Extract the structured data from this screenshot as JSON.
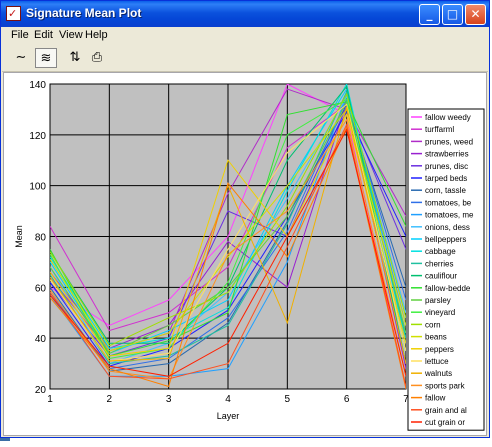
{
  "window": {
    "title": "Signature Mean Plot",
    "app_icon": "signature-plot-app-icon",
    "controls": [
      "minimize",
      "maximize",
      "close"
    ],
    "minimize_glyph": "_",
    "maximize_glyph": "□",
    "close_glyph": "✕",
    "app_icon_glyph": "✓"
  },
  "menu": [
    "File",
    "Edit",
    "View",
    "Help"
  ],
  "toolbar": {
    "tools": [
      {
        "name": "line-plot-icon",
        "glyph": "∼"
      },
      {
        "name": "multi-line-plot-icon",
        "glyph": "≋"
      },
      {
        "name": "switch-axes-icon",
        "glyph": "⇅"
      },
      {
        "name": "print-icon",
        "glyph": "⎙"
      }
    ]
  },
  "chart_data": {
    "type": "line",
    "xlabel": "Layer",
    "ylabel": "Mean",
    "x": [
      1,
      2,
      3,
      4,
      5,
      6,
      7
    ],
    "xlim": [
      1,
      7
    ],
    "ylim": [
      20,
      140
    ],
    "yticks": [
      20,
      40,
      60,
      80,
      100,
      120,
      140
    ],
    "grid": true,
    "background": "#c0c0c0",
    "legend_position": "right",
    "series": [
      {
        "name": "fallow weedy",
        "color": "#ff40ff",
        "values": [
          60,
          45,
          55,
          80,
          140,
          128,
          20
        ]
      },
      {
        "name": "turffarml",
        "color": "#d030d0",
        "values": [
          84,
          43,
          50,
          68,
          115,
          132,
          30
        ]
      },
      {
        "name": "prunes, weed",
        "color": "#b02cc8",
        "values": [
          64,
          35,
          42,
          97,
          138,
          130,
          88
        ]
      },
      {
        "name": "strawberries",
        "color": "#9920d0",
        "values": [
          66,
          36,
          45,
          78,
          60,
          133,
          28
        ]
      },
      {
        "name": "prunes, disc",
        "color": "#6a30e0",
        "values": [
          62,
          33,
          40,
          90,
          80,
          131,
          75
        ]
      },
      {
        "name": "tarped beds",
        "color": "#2020ff",
        "values": [
          62,
          29,
          36,
          51,
          88,
          129,
          80
        ]
      },
      {
        "name": "corn, tassle",
        "color": "#2a6ab0",
        "values": [
          60,
          27,
          30,
          46,
          86,
          132,
          60
        ]
      },
      {
        "name": "tomatoes, be",
        "color": "#3070e8",
        "values": [
          58,
          28,
          32,
          48,
          82,
          134,
          55
        ]
      },
      {
        "name": "tomatoes, me",
        "color": "#20a0ff",
        "values": [
          57,
          25,
          25,
          28,
          70,
          136,
          45
        ]
      },
      {
        "name": "onions, dess",
        "color": "#40c0ff",
        "values": [
          68,
          30,
          38,
          58,
          95,
          135,
          50
        ]
      },
      {
        "name": "bellpeppers",
        "color": "#00d0ff",
        "values": [
          70,
          34,
          43,
          55,
          100,
          138,
          40
        ]
      },
      {
        "name": "cabbage",
        "color": "#00e0e0",
        "values": [
          72,
          36,
          40,
          52,
          98,
          140,
          38
        ]
      },
      {
        "name": "cherries",
        "color": "#20c0a0",
        "values": [
          65,
          30,
          33,
          45,
          85,
          137,
          40
        ]
      },
      {
        "name": "cauliflour",
        "color": "#00c070",
        "values": [
          74,
          38,
          38,
          60,
          110,
          139,
          30
        ]
      },
      {
        "name": "fallow-bedde",
        "color": "#30e030",
        "values": [
          75,
          33,
          39,
          50,
          128,
          133,
          84
        ]
      },
      {
        "name": "parsley",
        "color": "#60d040",
        "values": [
          68,
          34,
          45,
          60,
          88,
          133,
          42
        ]
      },
      {
        "name": "vineyard",
        "color": "#40f040",
        "values": [
          73,
          32,
          36,
          62,
          120,
          134,
          35
        ]
      },
      {
        "name": "corn",
        "color": "#a0e000",
        "values": [
          74,
          37,
          48,
          58,
          92,
          136,
          48
        ]
      },
      {
        "name": "beans",
        "color": "#d0e000",
        "values": [
          71,
          35,
          42,
          72,
          100,
          130,
          45
        ]
      },
      {
        "name": "peppers",
        "color": "#f0d000",
        "values": [
          66,
          33,
          36,
          110,
          80,
          128,
          38
        ]
      },
      {
        "name": "lettuce",
        "color": "#ffe060",
        "values": [
          63,
          31,
          34,
          75,
          113,
          132,
          35
        ]
      },
      {
        "name": "walnuts",
        "color": "#f0b000",
        "values": [
          64,
          31,
          32,
          100,
          46,
          131,
          30
        ]
      },
      {
        "name": "sports park",
        "color": "#ff9020",
        "values": [
          59,
          27,
          24,
          73,
          90,
          126,
          25
        ]
      },
      {
        "name": "fallow",
        "color": "#ff8000",
        "values": [
          56,
          28,
          21,
          101,
          72,
          123,
          20
        ]
      },
      {
        "name": "grain and al",
        "color": "#ff5020",
        "values": [
          58,
          25,
          24,
          30,
          76,
          124,
          21
        ]
      },
      {
        "name": "cut grain or",
        "color": "#ff2000",
        "values": [
          57,
          29,
          25,
          38,
          80,
          122,
          25
        ]
      }
    ]
  }
}
